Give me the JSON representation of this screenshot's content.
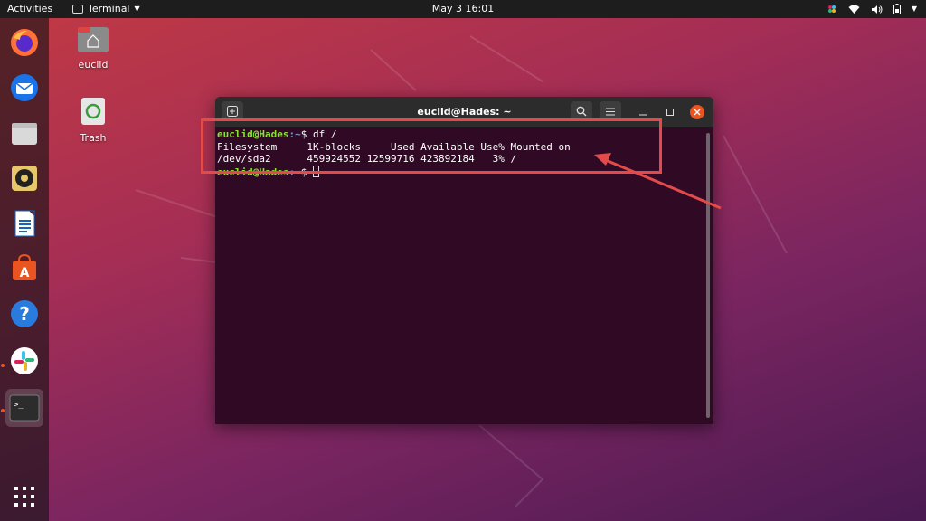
{
  "topbar": {
    "activities": "Activities",
    "app_menu": "Terminal",
    "clock": "May 3  16:01"
  },
  "dock": {
    "items": [
      {
        "name": "firefox"
      },
      {
        "name": "thunderbird"
      },
      {
        "name": "files"
      },
      {
        "name": "rhythmbox"
      },
      {
        "name": "libreoffice-writer"
      },
      {
        "name": "ubuntu-software"
      },
      {
        "name": "help"
      },
      {
        "name": "slack"
      },
      {
        "name": "terminal"
      },
      {
        "name": "show-applications"
      }
    ]
  },
  "desktop": {
    "home_label": "euclid",
    "trash_label": "Trash"
  },
  "terminal": {
    "title": "euclid@Hades: ~",
    "prompt_user": "euclid@Hades",
    "prompt_path": ":~",
    "line1_cmd": "$ df /",
    "line2": "Filesystem     1K-blocks     Used Available Use% Mounted on",
    "line3": "/dev/sda2      459924552 12599716 423892184   3% /",
    "line4_cmd": "$ "
  },
  "colors": {
    "terminal_bg": "#300a24",
    "prompt_user": "#8ae234",
    "prompt_path": "#729fcf",
    "annotation": "#e34a4a"
  }
}
